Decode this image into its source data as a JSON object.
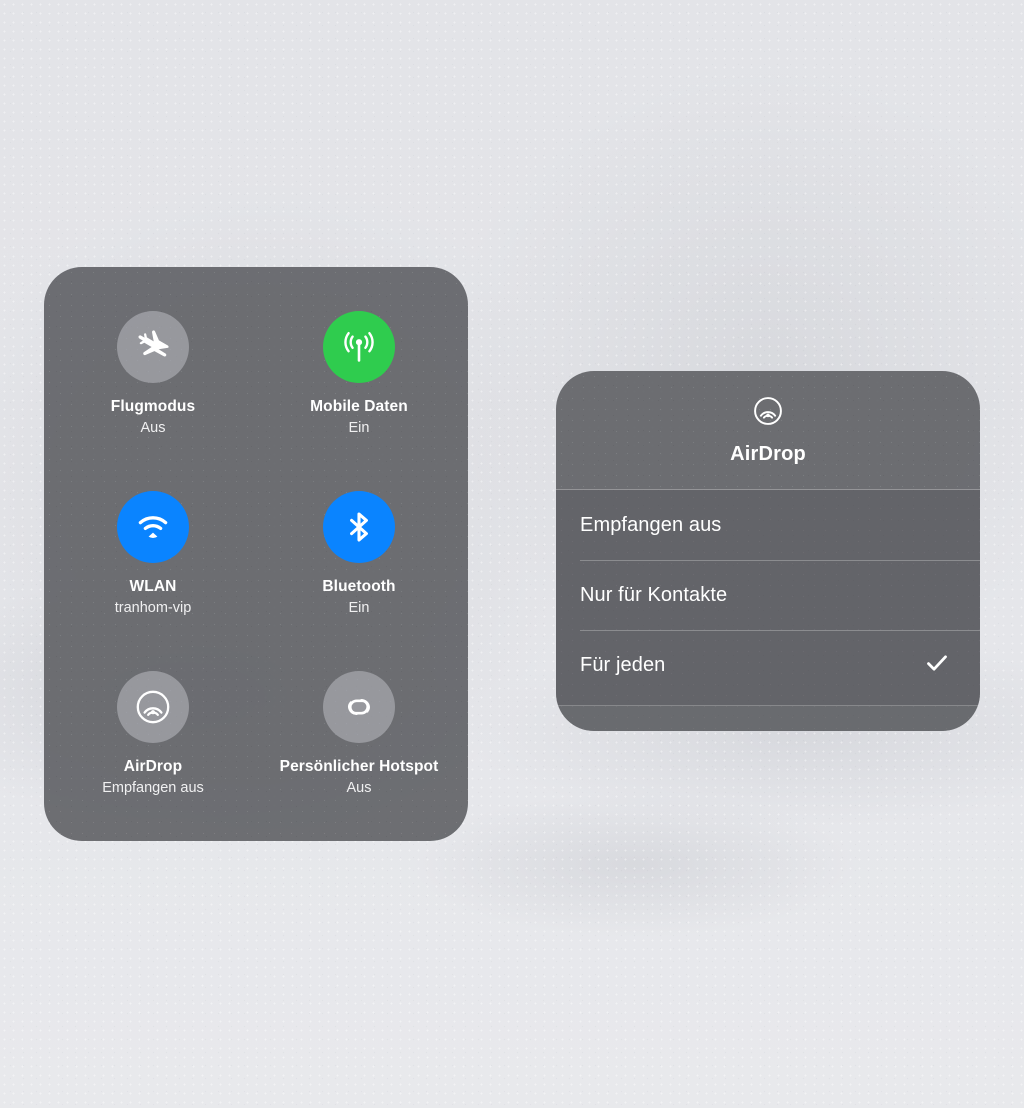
{
  "wallpaper": {
    "description": "blurred light grey wallpaper",
    "base_color": "#e5e6ea"
  },
  "control_center": {
    "panel_color": "#636468",
    "toggles": [
      {
        "name": "airplane-mode",
        "icon": "airplane-icon",
        "title": "Flugmodus",
        "status": "Aus",
        "state": "off",
        "icon_color": "#aaabb0"
      },
      {
        "name": "cellular-data",
        "icon": "cellular-antenna-icon",
        "title": "Mobile Daten",
        "status": "Ein",
        "state": "on",
        "icon_color": "#2fcc4e"
      },
      {
        "name": "wifi",
        "icon": "wifi-icon",
        "title": "WLAN",
        "status": "tranhom-vip",
        "state": "on",
        "icon_color": "#0a84ff"
      },
      {
        "name": "bluetooth",
        "icon": "bluetooth-icon",
        "title": "Bluetooth",
        "status": "Ein",
        "state": "on",
        "icon_color": "#0a84ff"
      },
      {
        "name": "airdrop",
        "icon": "airdrop-icon",
        "title": "AirDrop",
        "status": "Empfangen aus",
        "state": "off",
        "icon_color": "#aaabb0"
      },
      {
        "name": "personal-hotspot",
        "icon": "hotspot-link-icon",
        "title": "Persönlicher Hotspot",
        "status": "Aus",
        "state": "off",
        "icon_color": "#aaabb0"
      }
    ]
  },
  "airdrop_popup": {
    "icon": "airdrop-icon",
    "title": "AirDrop",
    "options": [
      {
        "label": "Empfangen aus",
        "selected": false
      },
      {
        "label": "Nur für Kontakte",
        "selected": false
      },
      {
        "label": "Für jeden",
        "selected": true
      }
    ],
    "checkmark_glyph": "✓",
    "selected_option": "Für jeden"
  }
}
